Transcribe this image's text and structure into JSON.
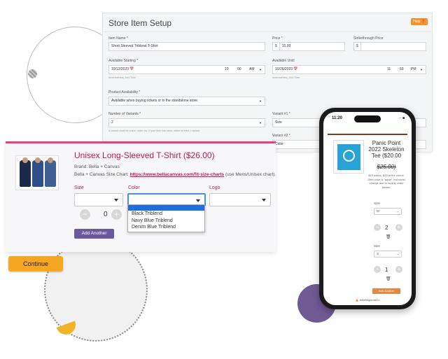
{
  "setup": {
    "title": "Store Item Setup",
    "badge": "Help ❓",
    "item_name_label": "Item Name *",
    "item_name_value": "Short Sleeved Triblend T-Shirt",
    "price_label": "Price *",
    "price_prefix": "$",
    "price_value": "15.00",
    "strike_label": "Strikethrough Price",
    "strike_prefix": "$",
    "avail_start_label": "Available Starting *",
    "avail_start_date": "10/12/2023 📅",
    "avail_start_hour": "10",
    "avail_start_min": "00",
    "avail_start_ampm": "AM",
    "avail_start_tz": "America/New_York Time",
    "avail_until_label": "Available Until",
    "avail_until_date": "10/26/2023 📅",
    "avail_until_hour": "11",
    "avail_until_min": "59",
    "avail_until_ampm": "PM",
    "avail_until_tz": "America/New_York Time",
    "availability_label": "Product Availability *",
    "availability_value": "Available when buying tickets or in the standalone store.",
    "variants_label": "Number of Variants *",
    "variants_value": "2",
    "variants_hint": "A variant could be a size, color, etc. If your item has sizes, select at least 1 variant.",
    "variant1_label": "Variant #1 *",
    "variant1_value": "Size",
    "variant2_label": "Variant #2 *",
    "variant2_value": "Color"
  },
  "product": {
    "title": "Unisex Long-Sleeved T-Shirt ($26.00)",
    "brand": "Brand: Bella + Canvas",
    "size_chart_prefix": "Bella + Canvas Size Chart:",
    "size_chart_link": "https://www.bellacanvas.com/fit-size-charts",
    "size_chart_suffix": "(use Mens/Unisex chart).",
    "size_label": "Size",
    "color_label": "Color",
    "logo_label": "Logo",
    "qty_minus": "−",
    "qty_value": "0",
    "qty_plus": "+",
    "add_another": "Add Another",
    "color_options": [
      "Black Triblend",
      "Navy Blue Triblend",
      "Denim Blue Triblend"
    ]
  },
  "continue_label": "Continue",
  "phone": {
    "time": "11:20",
    "status": "∙∙∙ ■",
    "title": "Panic Point 2022 Skeleton Tee ($20.00",
    "old_price": "$25.00)",
    "description": "$10 online, $25 at the venue. Shirt color is \"aqua\", but could change due to supply chain issues.",
    "size_label_1": "Size",
    "size_value_1": "M",
    "qty_1": "2",
    "size_label_2": "Size",
    "size_value_2": "S",
    "qty_2": "1",
    "add_another": "Add Another",
    "url": "🔒 ticketingsmart.io"
  }
}
